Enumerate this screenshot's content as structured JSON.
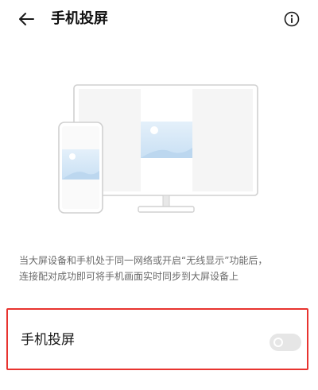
{
  "header": {
    "title": "手机投屏",
    "back_icon": "arrow-left-icon",
    "info_icon": "info-icon"
  },
  "illustration": {
    "icon": "phone-to-tv-illustration"
  },
  "description": {
    "line1": "当大屏设备和手机处于同一网络或开启“无线显示”功能后，",
    "line2": "连接配对成功即可将手机画面实时同步到大屏设备上"
  },
  "setting": {
    "label": "手机投屏",
    "enabled": false
  },
  "colors": {
    "highlight": "#e8332f",
    "toggle_off": "#e6e6e6",
    "text_secondary": "#6b6b6b",
    "screen_blue": "#d6e8f7"
  }
}
